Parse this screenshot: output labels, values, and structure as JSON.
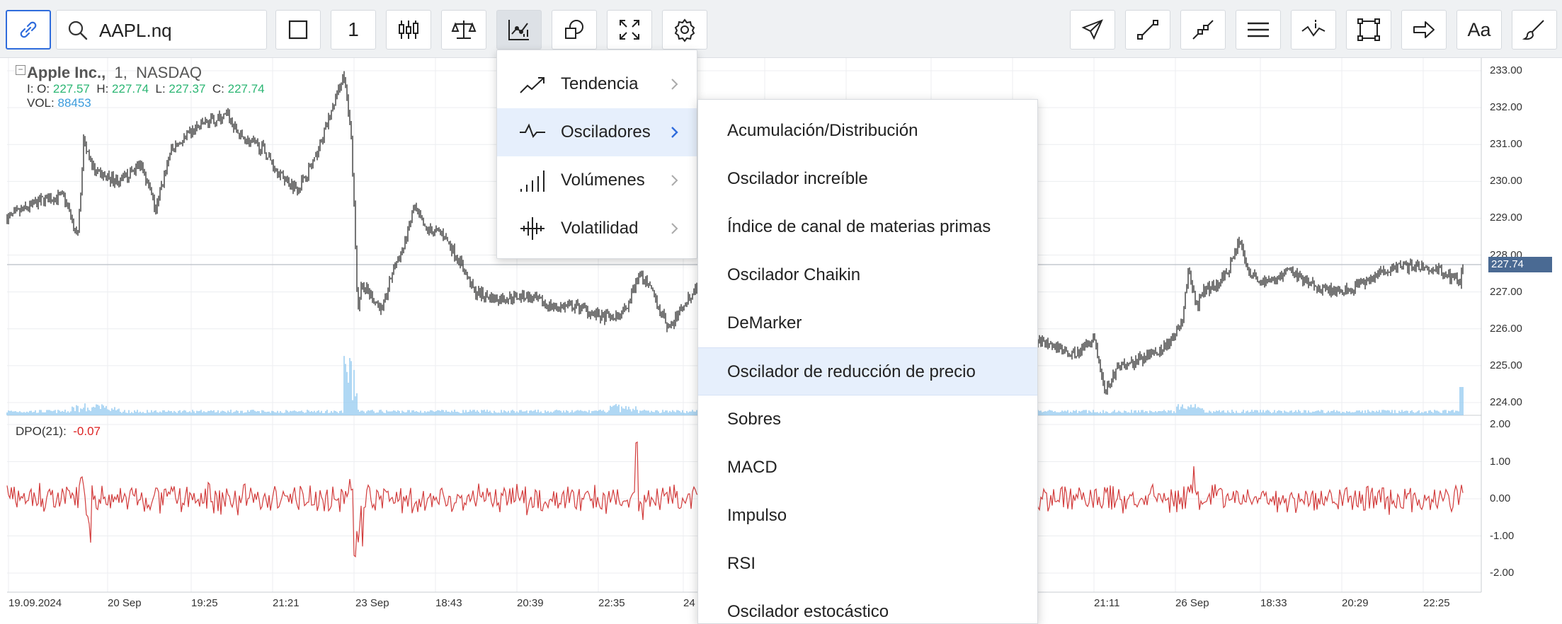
{
  "toolbar": {
    "symbol": "AAPL.nq",
    "interval": "1",
    "font_button": "Aa"
  },
  "chart": {
    "title": "Apple Inc.,",
    "interval": "1,",
    "exchange": "NASDAQ",
    "ohlc": {
      "open_label": "I: O:",
      "open": "227.57",
      "high_label": "H:",
      "high": "227.74",
      "low_label": "L:",
      "low": "227.37",
      "close_label": "C:",
      "close": "227.74"
    },
    "volume_label": "VOL:",
    "volume": "88453",
    "current_price": "227.74",
    "price_axis": [
      "233.00",
      "232.00",
      "231.00",
      "230.00",
      "229.00",
      "228.00",
      "227.00",
      "226.00",
      "225.00",
      "224.00"
    ],
    "indicator_label": "DPO(21):",
    "indicator_value": "-0.07",
    "indicator_axis": [
      "2.00",
      "1.00",
      "0.00",
      "-1.00",
      "-2.00"
    ],
    "time_axis": [
      "19.09.2024",
      "20 Sep",
      "19:25",
      "21:21",
      "23 Sep",
      "18:43",
      "20:39",
      "22:35",
      "24",
      "21:11",
      "26 Sep",
      "18:33",
      "20:29",
      "22:25"
    ],
    "colors": {
      "candle": "#2d2d2d",
      "volume": "#8fc8ef",
      "dpo": "#d23c3c",
      "price_tag": "#4a6a93"
    }
  },
  "menu": {
    "categories": [
      {
        "label": "Tendencia",
        "icon": "trend-icon"
      },
      {
        "label": "Osciladores",
        "icon": "oscillator-icon"
      },
      {
        "label": "Volúmenes",
        "icon": "volume-icon"
      },
      {
        "label": "Volatilidad",
        "icon": "volatility-icon"
      }
    ],
    "selected_category": "Osciladores",
    "oscillators": [
      "Acumulación/Distribución",
      "Oscilador increíble",
      "Índice de canal de materias primas",
      "Oscilador Chaikin",
      "DeMarker",
      "Oscilador de reducción de precio",
      "Sobres",
      "MACD",
      "Impulso",
      "RSI",
      "Oscilador estocástico"
    ],
    "highlighted_oscillator": "Oscilador de reducción de precio"
  }
}
